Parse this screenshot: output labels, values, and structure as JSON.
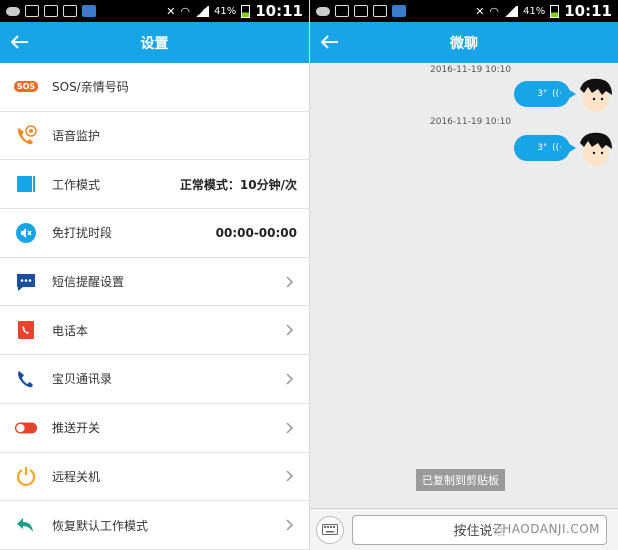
{
  "status_bar": {
    "battery_pct": "41%",
    "time": "10:11"
  },
  "settings": {
    "title": "设置",
    "items": [
      {
        "label": "SOS/亲情号码",
        "value": "",
        "icon": "sos-icon",
        "sos_badge": "SOS"
      },
      {
        "label": "语音监护",
        "value": "",
        "icon": "phone-monitor-icon"
      },
      {
        "label": "工作模式",
        "value": "正常模式：10分钟/次",
        "icon": "work-mode-icon"
      },
      {
        "label": "免打扰时段",
        "value": "00:00-00:00",
        "icon": "mute-icon"
      },
      {
        "label": "短信提醒设置",
        "value": "",
        "icon": "sms-icon"
      },
      {
        "label": "电话本",
        "value": "",
        "icon": "phonebook-icon"
      },
      {
        "label": "宝贝通讯录",
        "value": "",
        "icon": "contacts-icon"
      },
      {
        "label": "推送开关",
        "value": "",
        "icon": "toggle-icon"
      },
      {
        "label": "远程关机",
        "value": "",
        "icon": "power-icon"
      },
      {
        "label": "恢复默认工作模式",
        "value": "",
        "icon": "restore-icon"
      }
    ]
  },
  "chat": {
    "title": "微聊",
    "messages": [
      {
        "timestamp": "2016-11-19 10:10",
        "duration": "3\""
      },
      {
        "timestamp": "2016-11-19 10:10",
        "duration": "3\""
      }
    ],
    "toast": "已复制到剪贴板",
    "hold_to_talk": "按住说话",
    "watermark": "ZHAODANJI.COM"
  },
  "colors": {
    "accent": "#17a5e8",
    "orange": "#f08a24",
    "red": "#e8442d"
  }
}
